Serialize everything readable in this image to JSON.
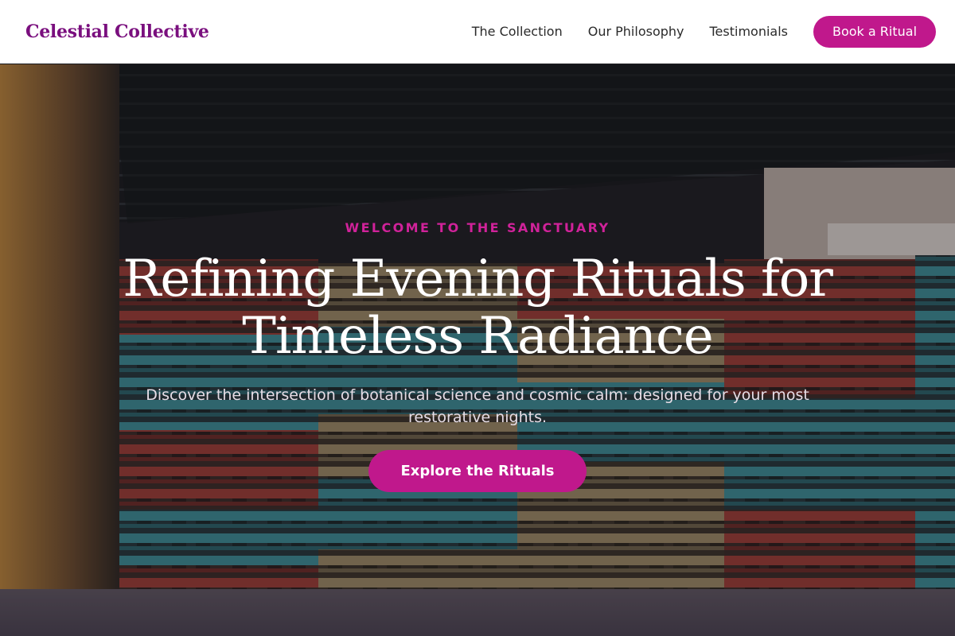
{
  "brand": {
    "name": "Celestial Collective",
    "color": "#7a0f7e"
  },
  "nav": {
    "links": [
      "The Collection",
      "Our Philosophy",
      "Testimonials"
    ],
    "cta_label": "Book a Ritual"
  },
  "hero": {
    "eyebrow": "WELCOME TO THE SANCTUARY",
    "title": "Refining Evening Rituals for Timeless Radiance",
    "subtitle": "Discover the intersection of botanical science and cosmic calm: designed for your most restorative nights.",
    "cta_label": "Explore the Rituals",
    "background": "photo of stacked colorful wooden pallets under a dark canopy"
  },
  "colors": {
    "accent": "#c0188c",
    "eyebrow": "#d0229a",
    "text_light": "#ffffff"
  }
}
